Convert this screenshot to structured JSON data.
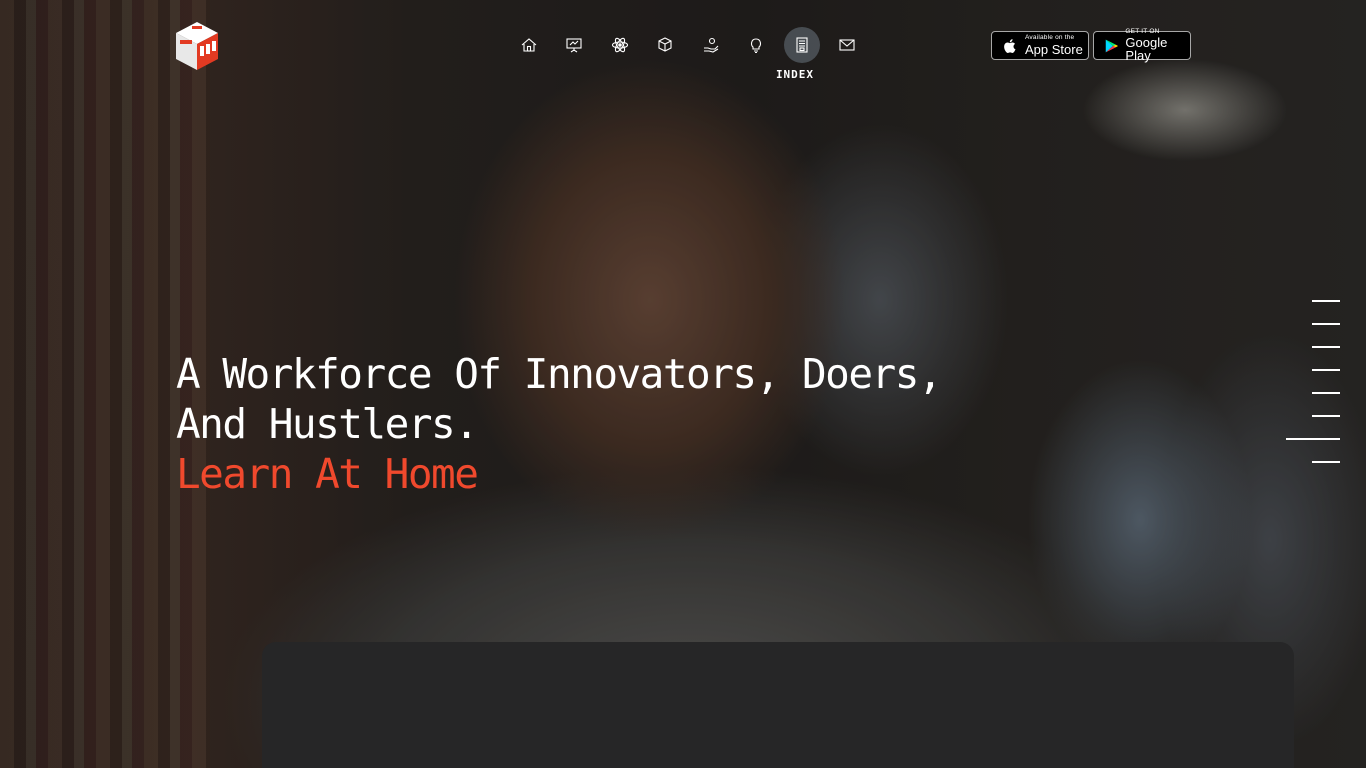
{
  "logo": {
    "icon": "red-white-cube-logo"
  },
  "nav": {
    "items": [
      {
        "icon": "home-icon",
        "label": ""
      },
      {
        "icon": "presentation-icon",
        "label": ""
      },
      {
        "icon": "atom-icon",
        "label": ""
      },
      {
        "icon": "box-icon",
        "label": ""
      },
      {
        "icon": "hand-coin-icon",
        "label": ""
      },
      {
        "icon": "lightbulb-icon",
        "label": ""
      },
      {
        "icon": "document-index-icon",
        "label": "INDEX",
        "active": true
      },
      {
        "icon": "mail-icon",
        "label": ""
      }
    ],
    "active_label": "INDEX"
  },
  "stores": {
    "apple": {
      "small": "Available on the",
      "big": "App Store",
      "icon": "apple-icon"
    },
    "google": {
      "small": "GET IT ON",
      "big": "Google Play",
      "icon": "google-play-icon"
    }
  },
  "hero": {
    "line1": "A Workforce Of Innovators, Doers,",
    "line2": "And Hustlers.",
    "line3": "Learn At Home"
  },
  "slides": {
    "count": 8,
    "active_index": 6
  },
  "colors": {
    "accent": "#f0492d",
    "text": "#ffffff"
  }
}
